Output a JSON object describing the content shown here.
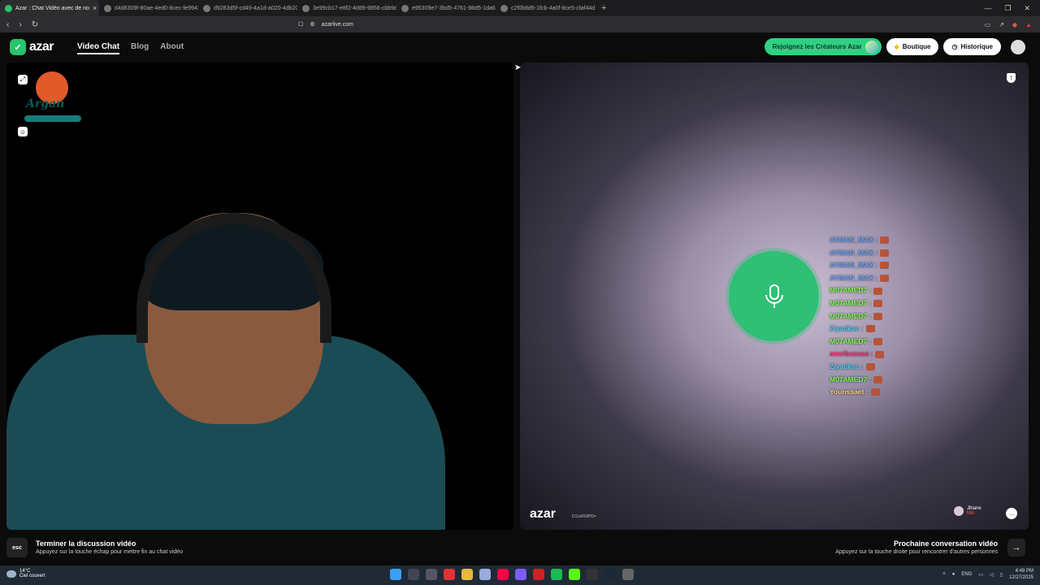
{
  "browser": {
    "tabs": [
      {
        "title": "Azar : Chat Vidéo avec de no",
        "active": true
      },
      {
        "title": "d4d8309f-80ae-4ed0-8cec-fe9942e0",
        "active": false
      },
      {
        "title": "d9283d5f-cd49-4a1d-a020-4db20fc",
        "active": false
      },
      {
        "title": "3e99cb17-e8f2-4d89-9856-cbb9d8",
        "active": false
      },
      {
        "title": "e95309e7-3bd5-4761-98d5-1da6b8",
        "active": false
      },
      {
        "title": "c2f0b8d9-1fcb-4a0f-8ce5-cfaf44d6",
        "active": false
      }
    ],
    "url": "azarlive.com"
  },
  "site": {
    "logo": "azar",
    "nav": [
      {
        "label": "Video Chat",
        "active": true
      },
      {
        "label": "Blog",
        "active": false
      },
      {
        "label": "About",
        "active": false
      }
    ],
    "creators_button": "Rejoignez les Créateurs Azar",
    "shop_button": "Boutique",
    "history_button": "Historique"
  },
  "overlay": {
    "logo_text": "Argan"
  },
  "chat": [
    {
      "name": "AYMAN_MAX :",
      "color": "#6aa7ff"
    },
    {
      "name": "AYMAN_MAX :",
      "color": "#6aa7ff"
    },
    {
      "name": "AYMAN_MAX :",
      "color": "#6aa7ff"
    },
    {
      "name": "AYMAN_MAX :",
      "color": "#6aa7ff"
    },
    {
      "name": "M07AMED7 :",
      "color": "#7cff4f"
    },
    {
      "name": "M07AMED7 :",
      "color": "#7cff4f"
    },
    {
      "name": "M07AMED7 :",
      "color": "#7cff4f"
    },
    {
      "name": "Ziyadkac :",
      "color": "#4fd2ff"
    },
    {
      "name": "M07AMED7 :",
      "color": "#7cff4f"
    },
    {
      "name": "amelbaaaaa :",
      "color": "#ff3d7f"
    },
    {
      "name": "Ziyadkac :",
      "color": "#4fd2ff"
    },
    {
      "name": "M07AMED7 :",
      "color": "#7cff4f"
    },
    {
      "name": "Younssaet :",
      "color": "#ffd27a"
    }
  ],
  "remote": {
    "watermark": "azar",
    "id": "D11sRGfPD+",
    "peer_name": "Jihane",
    "peer_country": "MA"
  },
  "controls": {
    "esc_label": "esc",
    "end_title": "Terminer la discussion vidéo",
    "end_subtitle": "Appuyez sur la touche échap pour mettre fin au chat vidéo",
    "next_title": "Prochaine conversation vidéo",
    "next_subtitle": "Appuyez sur la touche droite pour rencontrer d'autres personnes"
  },
  "taskbar": {
    "temperature": "14°C",
    "weather": "Ciel couvert",
    "lang": "ENG",
    "time": "4:48 PM",
    "date": "12/27/2025"
  },
  "colors": {
    "accent": "#27c46b",
    "mic": "#2fbf75"
  }
}
